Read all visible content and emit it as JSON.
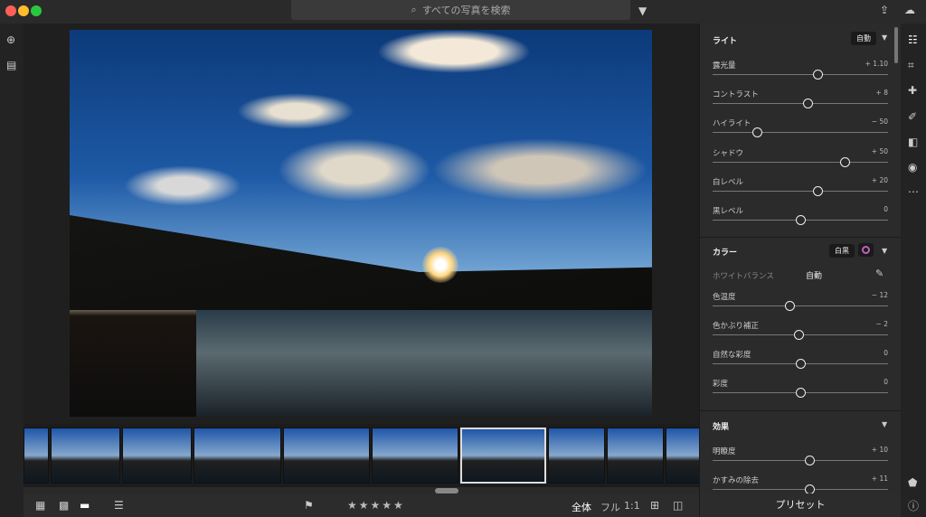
{
  "search": {
    "placeholder": "すべての写真を検索"
  },
  "light": {
    "title": "ライト",
    "auto": "自動",
    "sliders": [
      {
        "label": "露光量",
        "value": "+ 1.10",
        "pos": 0.6
      },
      {
        "label": "コントラスト",
        "value": "+ 8",
        "pos": 0.54
      },
      {
        "label": "ハイライト",
        "value": "− 50",
        "pos": 0.25
      },
      {
        "label": "シャドウ",
        "value": "+ 50",
        "pos": 0.75
      },
      {
        "label": "白レベル",
        "value": "+ 20",
        "pos": 0.6
      },
      {
        "label": "黒レベル",
        "value": "0",
        "pos": 0.5
      }
    ]
  },
  "color": {
    "title": "カラー",
    "bw": "白黒",
    "wb_label": "ホワイトバランス",
    "wb_value": "自動",
    "sliders": [
      {
        "label": "色温度",
        "value": "− 12",
        "pos": 0.44
      },
      {
        "label": "色かぶり補正",
        "value": "− 2",
        "pos": 0.49
      },
      {
        "label": "自然な彩度",
        "value": "0",
        "pos": 0.5
      },
      {
        "label": "彩度",
        "value": "0",
        "pos": 0.5
      }
    ]
  },
  "effects": {
    "title": "効果",
    "sliders": [
      {
        "label": "明瞭度",
        "value": "+ 10",
        "pos": 0.55
      },
      {
        "label": "かすみの除去",
        "value": "+ 11",
        "pos": 0.55
      }
    ]
  },
  "preset_label": "プリセット",
  "bottom": {
    "stars": "★★★★★",
    "view_all": "全体",
    "view_full": "フル",
    "view_1to1": "1:1"
  },
  "colors": {
    "accent": "#1a1a1a",
    "bg": "#1e1e1e"
  }
}
